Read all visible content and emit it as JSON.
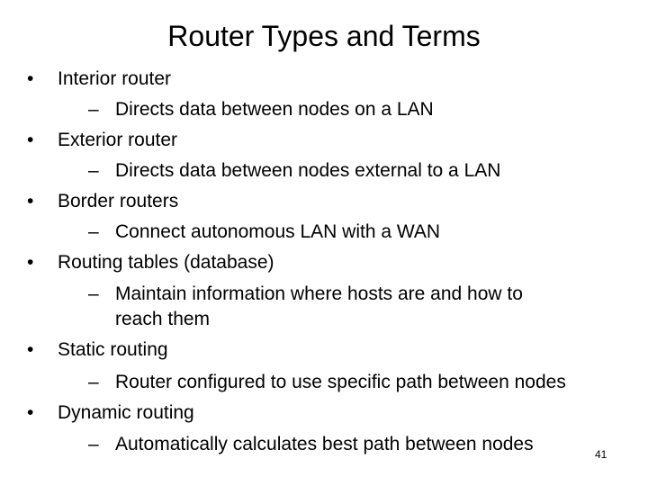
{
  "slide": {
    "title": "Router Types and Terms",
    "bullet_glyph": "•",
    "dash_glyph": "–",
    "items": [
      {
        "label": "Interior router",
        "sub": [
          "Directs data between nodes on a LAN"
        ]
      },
      {
        "label": "Exterior router",
        "sub": [
          "Directs data between nodes external to a LAN"
        ]
      },
      {
        "label": "Border routers",
        "sub": [
          "Connect autonomous LAN with a WAN"
        ]
      },
      {
        "label": "Routing tables (database)",
        "sub": [
          "Maintain information where hosts are and how to",
          "reach them"
        ]
      },
      {
        "label": "Static routing",
        "sub": [
          "Router configured to use specific path between nodes"
        ]
      },
      {
        "label": "Dynamic routing",
        "sub": [
          "Automatically calculates best path between nodes"
        ]
      }
    ],
    "page_number": "41"
  }
}
